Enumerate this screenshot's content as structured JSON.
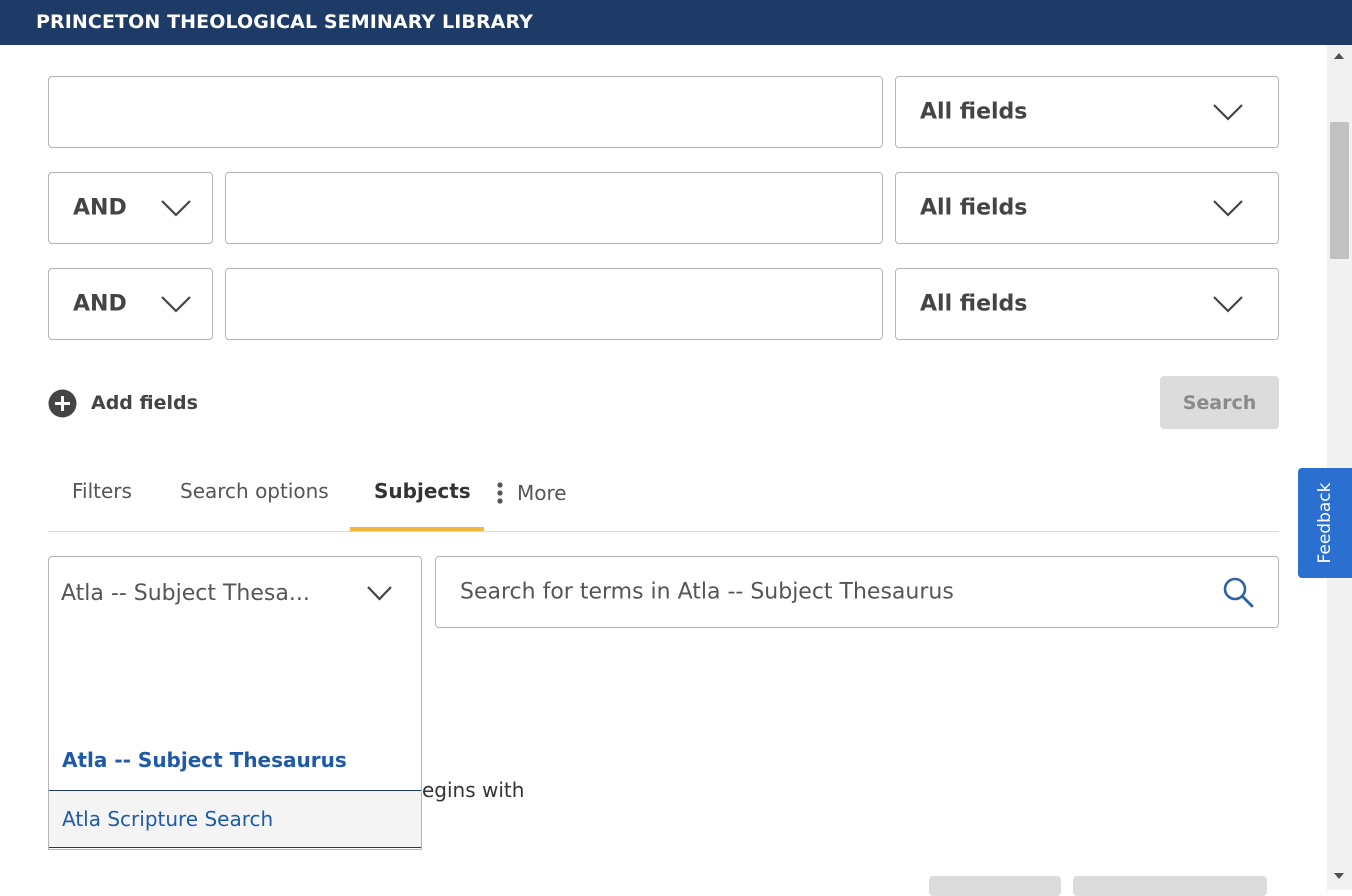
{
  "header": {
    "title": "PRINCETON THEOLOGICAL SEMINARY LIBRARY"
  },
  "advanced_search": {
    "rows": [
      {
        "operator": "",
        "query": "",
        "field": "All fields"
      },
      {
        "operator": "AND",
        "query": "",
        "field": "All fields"
      },
      {
        "operator": "AND",
        "query": "",
        "field": "All fields"
      }
    ],
    "add_fields_label": "Add fields",
    "search_button": "Search"
  },
  "tabs": [
    {
      "label": "Filters",
      "active": false
    },
    {
      "label": "Search options",
      "active": false
    },
    {
      "label": "Subjects",
      "active": true
    },
    {
      "label": "More",
      "active": false
    }
  ],
  "subjects": {
    "vocabulary_selected": "Atla -- Subject Thesa...",
    "dropdown_filter_value": "",
    "dropdown_options": [
      "Atla -- Subject Thesaurus",
      "Atla Scripture Search"
    ],
    "term_search_placeholder": "Search for terms in Atla -- Subject Thesaurus",
    "partial_text": "egins with"
  },
  "feedback_label": "Feedback",
  "colors": {
    "header_bg": "#1e3a66",
    "tab_underline": "#f0b83a",
    "link": "#1e5aa8",
    "feedback_bg": "#2b6fd1"
  },
  "icons": [
    "chevron-down-icon",
    "plus-circle-icon",
    "kebab-icon",
    "search-icon",
    "scroll-up-icon",
    "scroll-down-icon"
  ]
}
